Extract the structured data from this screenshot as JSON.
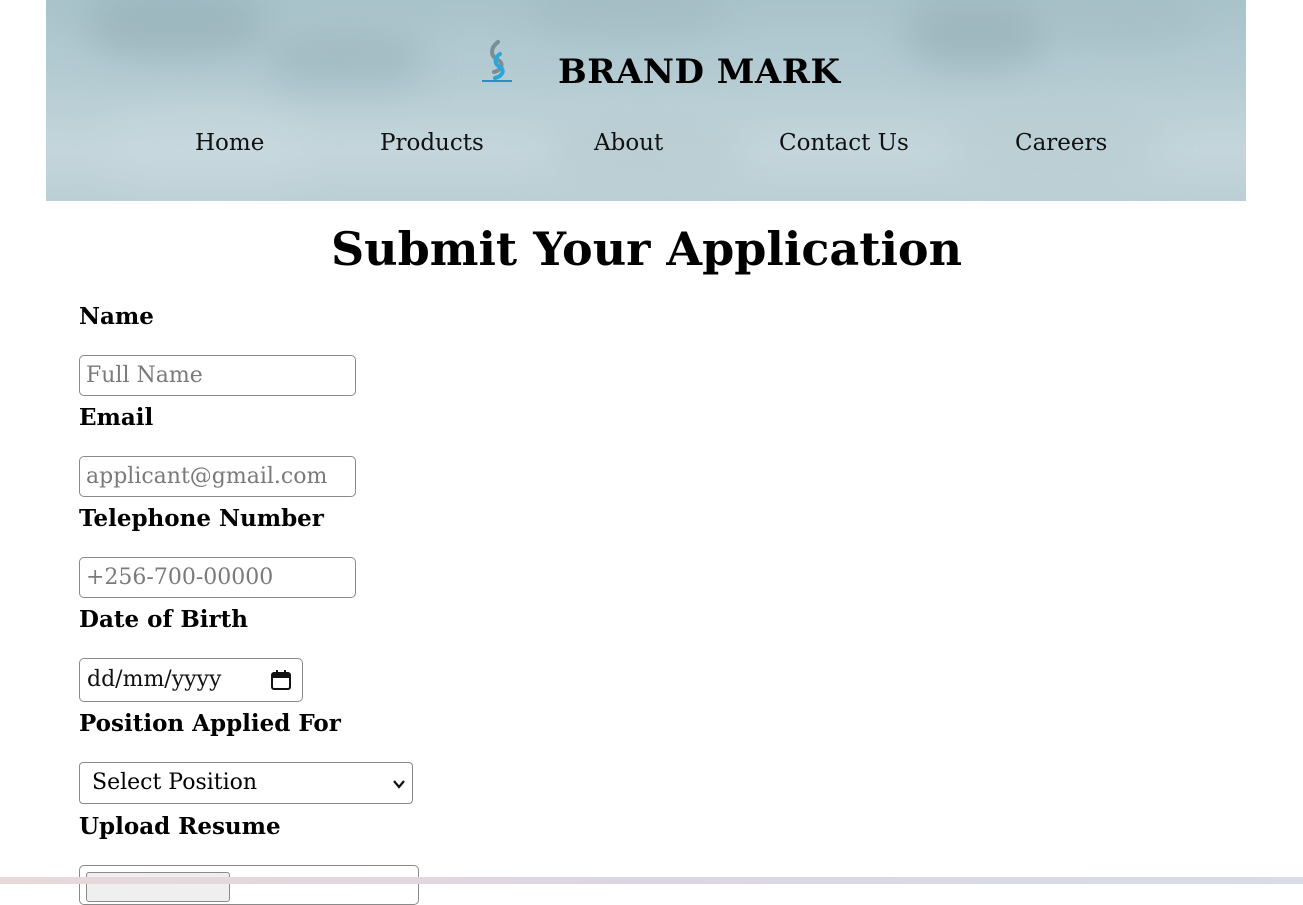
{
  "header": {
    "brand_title": "BRAND MARK",
    "logo_icon": "brandmark-logo-icon",
    "background_color": "#b7cdd4"
  },
  "nav": {
    "items": [
      {
        "label": "Home"
      },
      {
        "label": "Products"
      },
      {
        "label": "About"
      },
      {
        "label": "Contact Us"
      },
      {
        "label": "Careers"
      }
    ]
  },
  "page": {
    "title": "Submit Your Application"
  },
  "form": {
    "name": {
      "label": "Name",
      "placeholder": "Full Name"
    },
    "email": {
      "label": "Email",
      "placeholder": "applicant@gmail.com"
    },
    "phone": {
      "label": "Telephone Number",
      "placeholder": "+256-700-00000"
    },
    "dob": {
      "label": "Date of Birth",
      "value_format": "dd/mm/yyyy",
      "icon": "calendar-icon"
    },
    "position": {
      "label": "Position Applied For",
      "selected": "Select Position",
      "icon": "chevron-down-icon"
    },
    "resume": {
      "label": "Upload Resume"
    }
  }
}
